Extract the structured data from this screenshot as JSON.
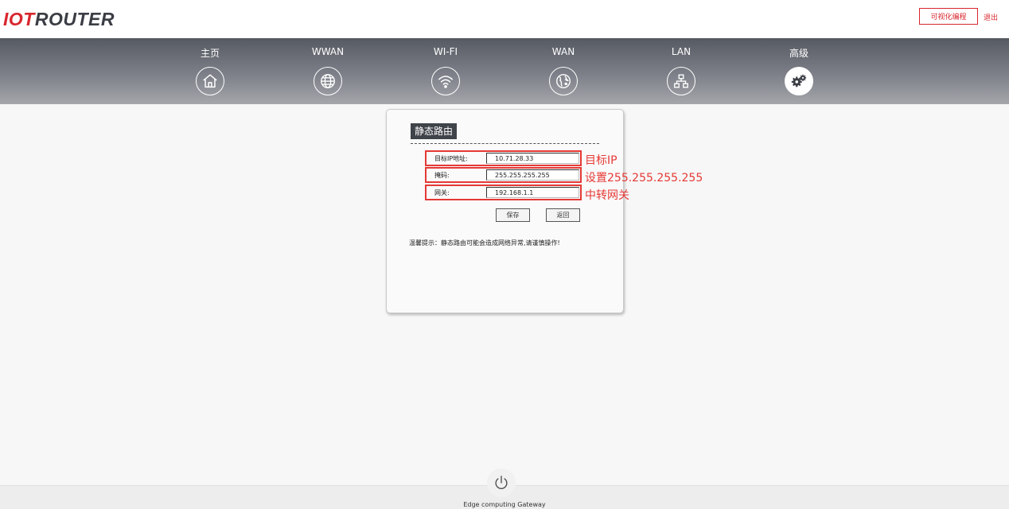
{
  "header": {
    "logo_prefix": "IOT",
    "logo_rest": "ROUTER",
    "visual_programming_label": "可视化编程",
    "logout_label": "退出"
  },
  "nav": {
    "items": [
      {
        "label": "主页",
        "icon": "home-icon"
      },
      {
        "label": "WWAN",
        "icon": "globe-icon"
      },
      {
        "label": "WI-FI",
        "icon": "wifi-icon"
      },
      {
        "label": "WAN",
        "icon": "earth-icon"
      },
      {
        "label": "LAN",
        "icon": "network-icon"
      },
      {
        "label": "高级",
        "icon": "gears-icon",
        "active": true
      }
    ]
  },
  "form": {
    "title": "静态路由",
    "fields": [
      {
        "label": "目标IP地址:",
        "value": "10.71.28.33"
      },
      {
        "label": "掩码:",
        "value": "255.255.255.255"
      },
      {
        "label": "网关:",
        "value": "192.168.1.1"
      }
    ],
    "save_label": "保存",
    "back_label": "返回",
    "tip": "温馨提示：静态路由可能会造成网络异常,请谨慎操作!"
  },
  "annotations": [
    "目标IP",
    "设置255.255.255.255",
    "中转网关"
  ],
  "footer": {
    "text": "Edge computing Gateway"
  },
  "colors": {
    "accent": "#d8262d",
    "annotation": "#e53935",
    "nav_top": "#565a62",
    "nav_bottom": "#a4a6ab"
  }
}
